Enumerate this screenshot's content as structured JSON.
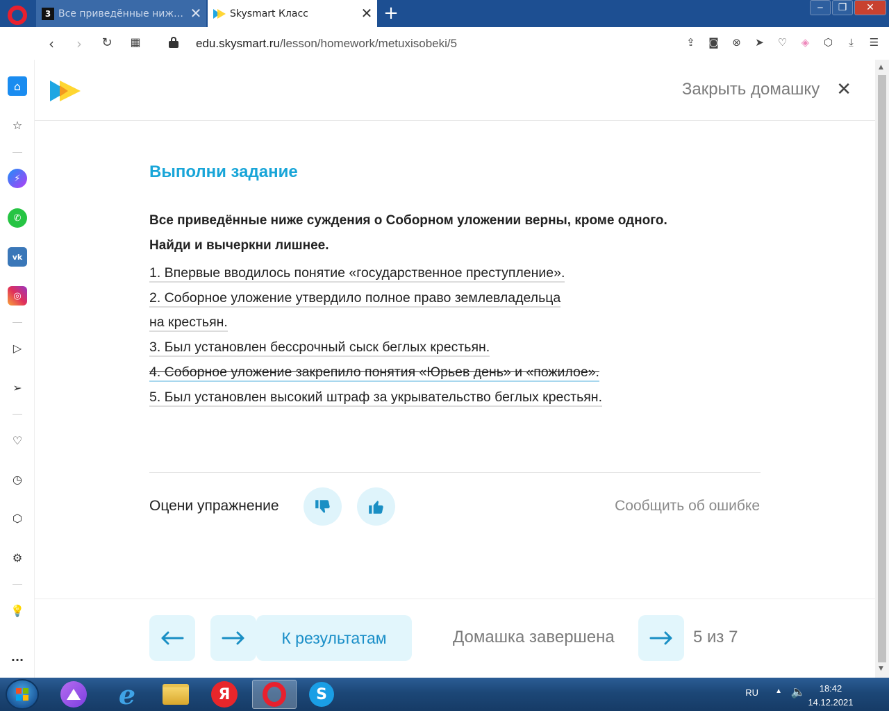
{
  "browser": {
    "tabs": [
      {
        "title": "Все приведённые ниже суждения",
        "favicon_text": "3"
      },
      {
        "title": "Skysmart Класс"
      }
    ],
    "url_host": "edu.skysmart.ru",
    "url_path": "/lesson/homework/metuxisobeki/5"
  },
  "header": {
    "close_label": "Закрыть домашку"
  },
  "task": {
    "heading": "Выполни задание",
    "question_line1": "Все приведённые ниже суждения о Соборном уложении верны, кроме одного.",
    "question_line2": "Найди и вычеркни лишнее.",
    "options": [
      {
        "text": "1. Впервые вводилось понятие «государственное преступление».",
        "struck": false
      },
      {
        "text": "2. Соборное уложение утвердило полное право землевладельца",
        "struck": false
      },
      {
        "text": "на крестьян.",
        "struck": false
      },
      {
        "text": "3. Был установлен бессрочный сыск беглых крестьян.",
        "struck": false
      },
      {
        "text": "4. Соборное уложение закрепило понятия «Юрьев день» и «пожилое».",
        "struck": true
      },
      {
        "text": "5. Был установлен высокий штраф за укрывательство беглых крестьян.",
        "struck": false
      }
    ]
  },
  "rating": {
    "label": "Оцени упражнение",
    "report_label": "Сообщить об ошибке"
  },
  "footer": {
    "results_label": "К результатам",
    "done_label": "Домашка завершена",
    "counter": "5 из 7"
  },
  "taskbar": {
    "lang": "RU",
    "time": "18:42",
    "date": "14.12.2021",
    "apps": [
      "alice-icon",
      "internet-explorer-icon",
      "file-explorer-icon",
      "yandex-browser-icon",
      "opera-icon",
      "skype-icon"
    ]
  },
  "colors": {
    "accent": "#18a5d8",
    "button_bg": "#e2f6fc",
    "brand_yellow": "#ffd21f",
    "brand_blue": "#1ea6e3"
  }
}
